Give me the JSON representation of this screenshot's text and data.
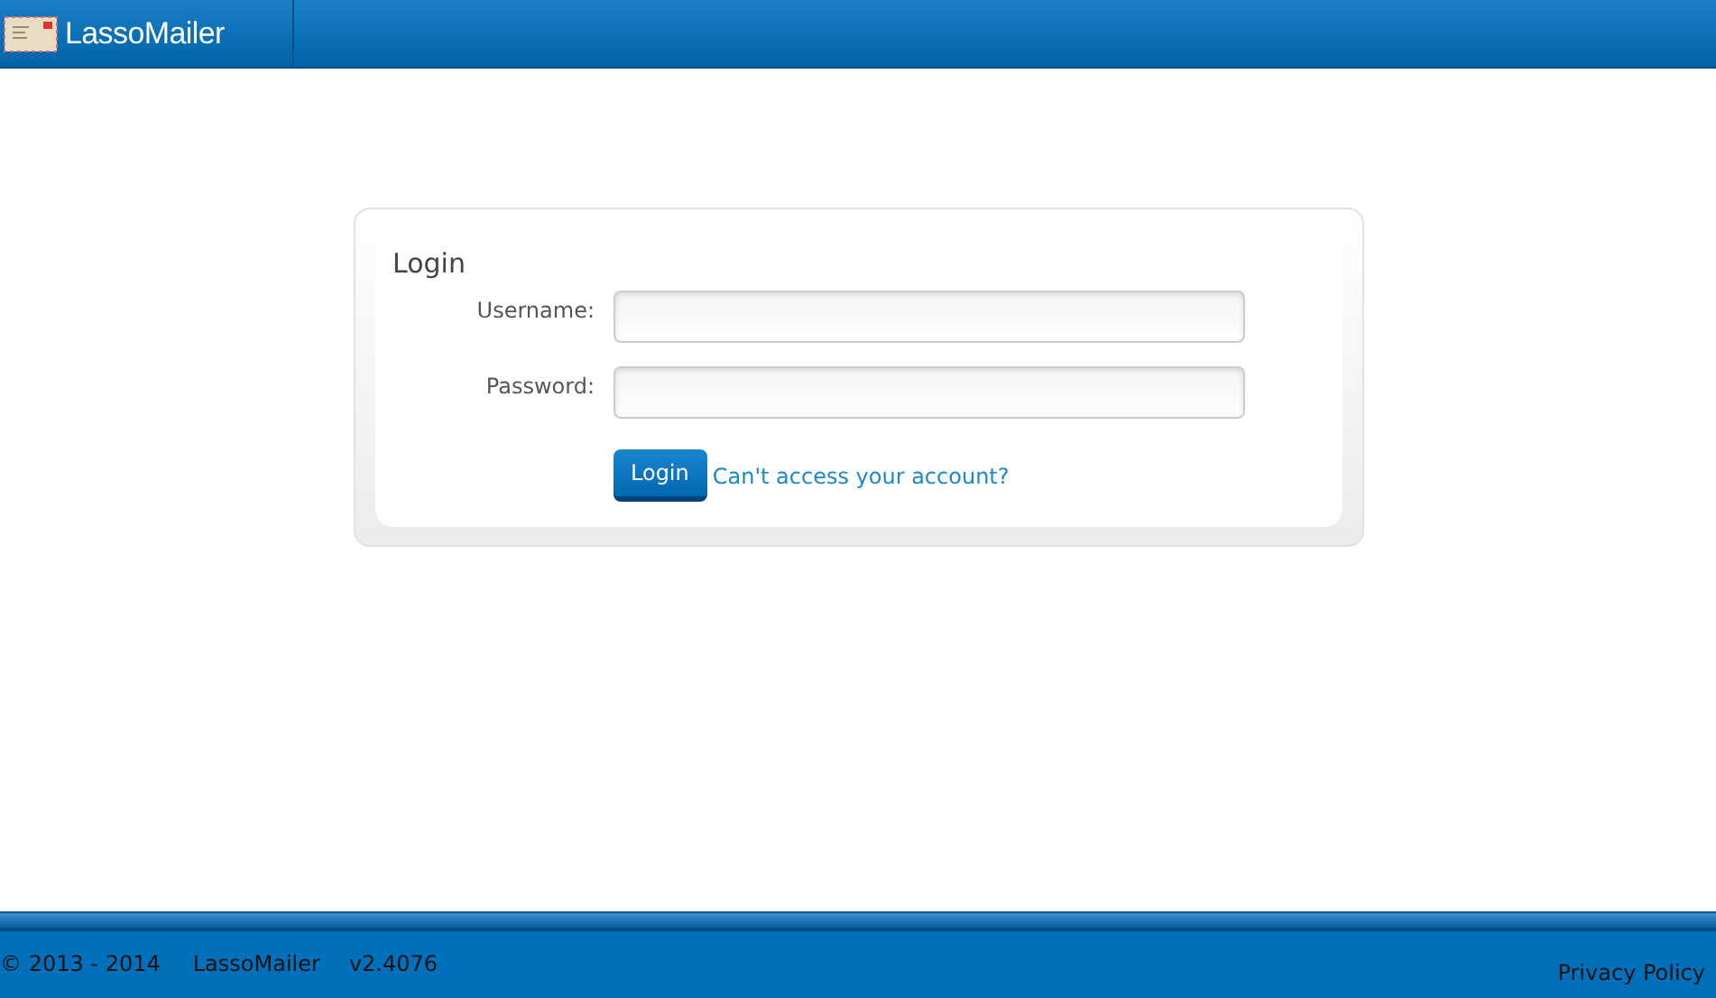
{
  "header": {
    "app_name": "LassoMailer"
  },
  "login": {
    "title": "Login",
    "fields": [
      {
        "label": "Username:"
      },
      {
        "label": "Password:"
      }
    ],
    "button": "Login",
    "help_link": "Can't access your account?"
  },
  "footer": {
    "copyright": "© 2013 - 2014",
    "product": "LassoMailer",
    "version": "v2.4076",
    "privacy_link": "Privacy Policy"
  }
}
